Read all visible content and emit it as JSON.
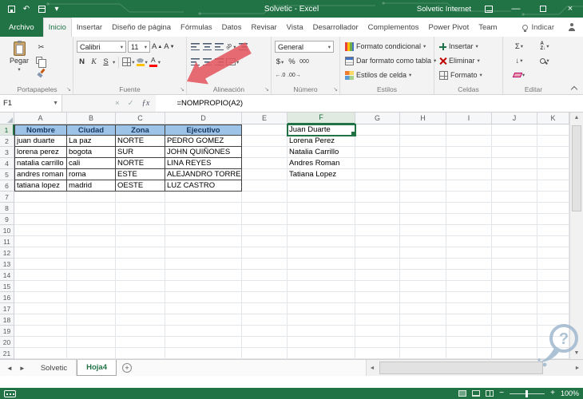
{
  "colors": {
    "excel_green": "#217346",
    "table_header_fill": "#9DC3E6",
    "selection_border": "#217346",
    "annotation_arrow": "#E2575F",
    "watermark": "#9FB9CE"
  },
  "title_bar": {
    "title": "Solvetic - Excel",
    "account": "Solvetic Internet"
  },
  "ribbon": {
    "file_tab": "Archivo",
    "tabs": [
      "Inicio",
      "Insertar",
      "Diseño de página",
      "Fórmulas",
      "Datos",
      "Revisar",
      "Vista",
      "Desarrollador",
      "Complementos",
      "Power Pivot",
      "Team"
    ],
    "active_tab": "Inicio",
    "tell_me": "Indicar",
    "clipboard": {
      "label": "Portapapeles",
      "paste": "Pegar"
    },
    "font": {
      "label": "Fuente",
      "family": "Calibri",
      "size": "11",
      "bold": "N",
      "italic": "K",
      "underline": "S"
    },
    "alignment": {
      "label": "Alineación"
    },
    "number": {
      "label": "Número",
      "format": "General",
      "currency": "$",
      "percent": "%",
      "thousands": "000",
      "inc_decimal": "←.0",
      "dec_decimal": ".00→"
    },
    "styles": {
      "label": "Estilos",
      "buttons": [
        "Formato condicional",
        "Dar formato como tabla",
        "Estilos de celda"
      ]
    },
    "cells": {
      "label": "Celdas",
      "buttons": [
        "Insertar",
        "Eliminar",
        "Formato"
      ]
    },
    "editing": {
      "label": "Editar",
      "autosum": "Σ"
    }
  },
  "formula_bar": {
    "name_box": "F1",
    "formula": "=NOMPROPIO(A2)"
  },
  "grid": {
    "column_headers": [
      "A",
      "B",
      "C",
      "D",
      "E",
      "F",
      "G",
      "H",
      "I",
      "J",
      "K"
    ],
    "row_count": 21,
    "selected_cell": "F1",
    "selected_column": "F",
    "selected_row": "1",
    "table": {
      "headers": [
        "Nombre",
        "Ciudad",
        "Zona",
        "Ejecutivo"
      ],
      "rows": [
        [
          "juan duarte",
          "La paz",
          "NORTE",
          "PEDRO GOMEZ"
        ],
        [
          "lorena perez",
          "bogota",
          "SUR",
          "JOHN QUIÑONES"
        ],
        [
          "natalia carrillo",
          "cali",
          "NORTE",
          "LINA REYES"
        ],
        [
          "andres roman",
          "roma",
          "ESTE",
          "ALEJANDRO TORRES"
        ],
        [
          "tatiana lopez",
          "madrid",
          "OESTE",
          "LUZ CASTRO"
        ]
      ]
    },
    "result_column": {
      "column": "F",
      "values": [
        "Juan Duarte",
        "Lorena Perez",
        "Natalia Carrillo",
        "Andres Roman",
        "Tatiana Lopez"
      ]
    }
  },
  "sheet_bar": {
    "tabs": [
      "Solvetic",
      "Hoja4"
    ],
    "active_tab": "Hoja4"
  },
  "status_bar": {
    "zoom": "100%"
  }
}
